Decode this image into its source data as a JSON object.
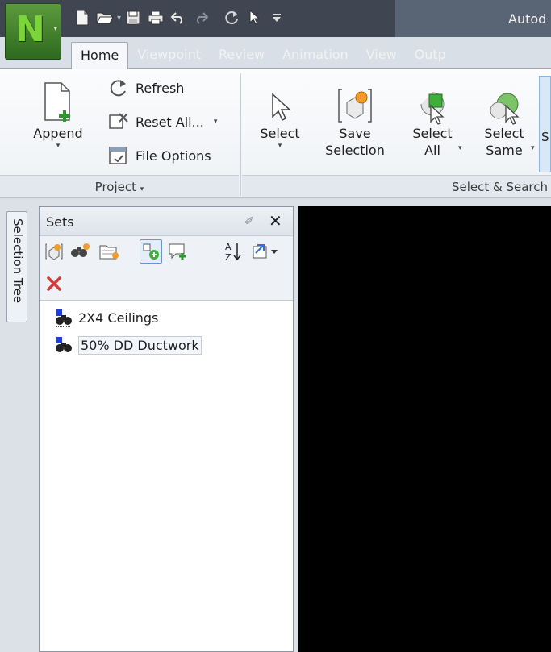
{
  "app": {
    "title_partial": "Autod",
    "colors": {
      "brand_green": "#5c9a3c",
      "accent_blue": "#2f6fd1",
      "viewport": "#000000"
    }
  },
  "quick_access": {
    "icons": [
      "new-file-icon",
      "open-folder-icon",
      "save-icon",
      "print-icon",
      "undo-icon",
      "redo-icon",
      "refresh-icon",
      "select-cursor-icon",
      "customize-dropdown-icon"
    ]
  },
  "tabs": [
    {
      "label": "Home",
      "active": true
    },
    {
      "label": "Viewpoint"
    },
    {
      "label": "Review"
    },
    {
      "label": "Animation"
    },
    {
      "label": "View"
    },
    {
      "label": "Outp"
    }
  ],
  "ribbon": {
    "project": {
      "title": "Project",
      "append": "Append",
      "refresh": "Refresh",
      "reset_all": "Reset All...",
      "file_options": "File Options"
    },
    "select_search": {
      "title": "Select & Search",
      "select": "Select",
      "save_line1": "Save",
      "save_line2": "Selection",
      "select_all_line1": "Select",
      "select_all_line2": "All",
      "select_same_line1": "Select",
      "select_same_line2": "Same",
      "partial": "S"
    }
  },
  "side_tab": {
    "label": "Selection Tree"
  },
  "sets_panel": {
    "title": "Sets",
    "toolbar_icons": [
      "save-selection-icon",
      "save-search-icon",
      "new-folder-icon",
      "duplicate-icon",
      "add-comment-icon",
      "sort-az-icon",
      "import-export-icon",
      "delete-icon"
    ],
    "items": [
      {
        "label": "2X4 Ceilings",
        "selected": false
      },
      {
        "label": "50% DD Ductwork",
        "selected": true
      }
    ]
  }
}
